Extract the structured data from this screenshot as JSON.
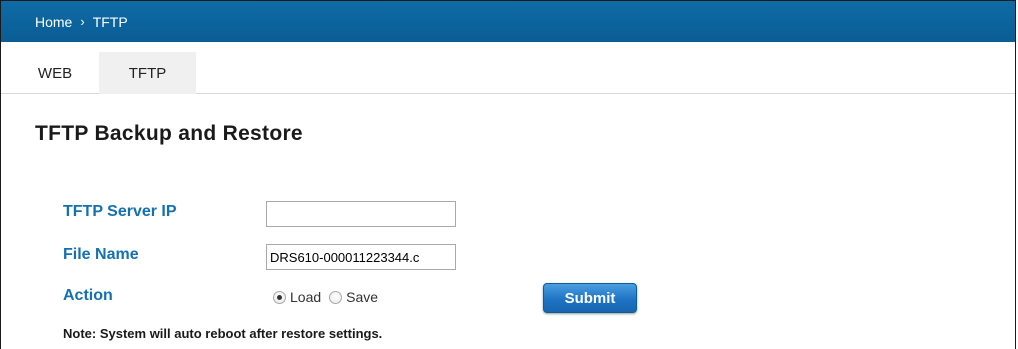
{
  "breadcrumb": {
    "home": "Home",
    "separator": "›",
    "current": "TFTP"
  },
  "tabs": [
    {
      "label": "WEB",
      "active": false
    },
    {
      "label": "TFTP",
      "active": true
    }
  ],
  "page_title": "TFTP Backup and Restore",
  "form": {
    "server_ip_label": "TFTP Server IP",
    "server_ip_value": "",
    "file_name_label": "File Name",
    "file_name_value": "DRS610-000011223344.c",
    "action_label": "Action",
    "action_options": [
      {
        "label": "Load",
        "selected": true
      },
      {
        "label": "Save",
        "selected": false
      }
    ],
    "submit_label": "Submit"
  },
  "note": "Note: System will auto reboot after restore settings.",
  "colors": {
    "header_bar": "#0f6ba6",
    "label_blue": "#1570b0",
    "button_blue": "#1f74c4"
  }
}
